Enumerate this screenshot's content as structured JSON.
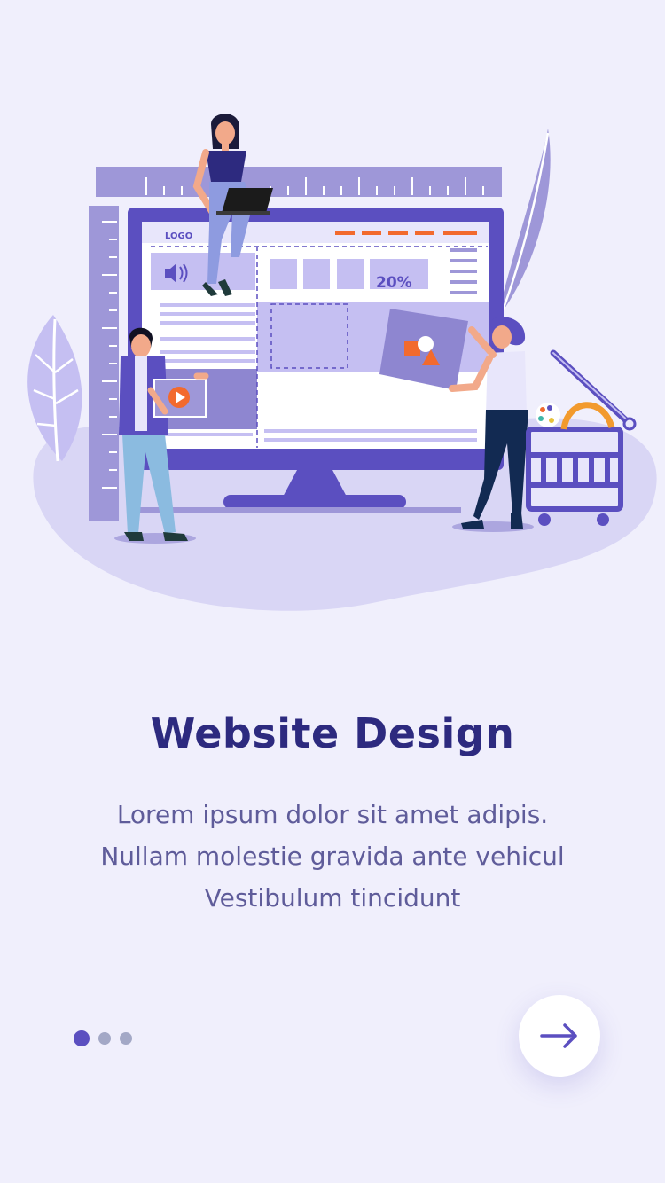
{
  "screen": {
    "title": "Website Design",
    "description_lines": [
      "Lorem ipsum dolor sit amet adipis.",
      "Nullam molestie gravida ante vehicul",
      "Vestibulum tincidunt"
    ]
  },
  "illustration": {
    "logo_text": "LOGO",
    "discount_text": "20%"
  },
  "pagination": {
    "total": 3,
    "current": 1
  },
  "icons": {
    "next": "arrow-right-icon"
  },
  "colors": {
    "background": "#f0effc",
    "title": "#2d2a7f",
    "text": "#5f5c9a",
    "accent": "#5b4fc0",
    "dot_inactive": "#a3a8c6",
    "highlight": "#f26a2e"
  }
}
